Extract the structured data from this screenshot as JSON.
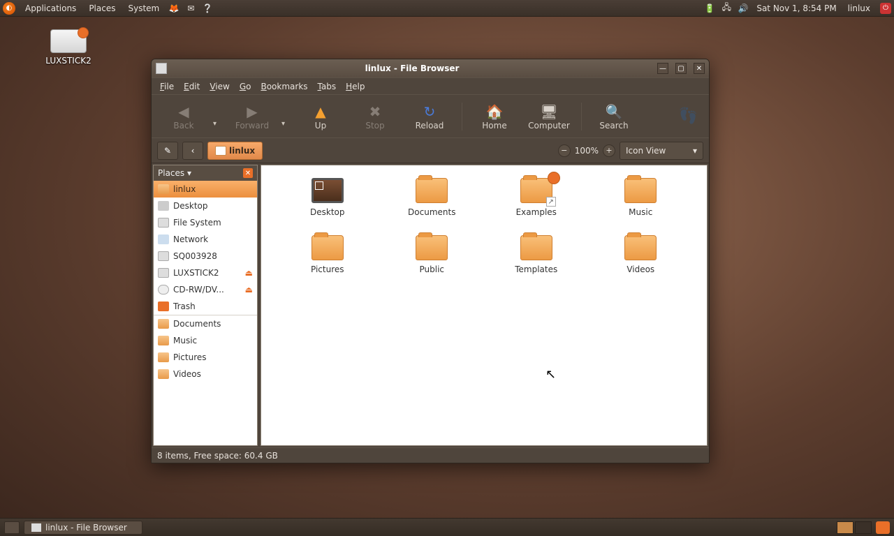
{
  "top_panel": {
    "menus": [
      "Applications",
      "Places",
      "System"
    ],
    "clock": "Sat Nov  1,  8:54 PM",
    "user": "linlux"
  },
  "desktop": {
    "drive_label": "LUXSTICK2"
  },
  "window": {
    "title": "linlux - File Browser",
    "menubar": {
      "file": "File",
      "edit": "Edit",
      "view": "View",
      "go": "Go",
      "bookmarks": "Bookmarks",
      "tabs": "Tabs",
      "help": "Help"
    },
    "toolbar": {
      "back": "Back",
      "forward": "Forward",
      "up": "Up",
      "stop": "Stop",
      "reload": "Reload",
      "home": "Home",
      "computer": "Computer",
      "search": "Search"
    },
    "location": {
      "current": "linlux",
      "zoom": "100%",
      "view_mode": "Icon View"
    },
    "sidebar": {
      "header": "Places",
      "places": [
        {
          "label": "linlux",
          "icon": "home",
          "selected": true
        },
        {
          "label": "Desktop",
          "icon": "desk"
        },
        {
          "label": "File System",
          "icon": "drive"
        },
        {
          "label": "Network",
          "icon": "net"
        },
        {
          "label": "SQ003928",
          "icon": "drive"
        },
        {
          "label": "LUXSTICK2",
          "icon": "drive",
          "eject": true
        },
        {
          "label": "CD-RW/DV...",
          "icon": "cd",
          "eject": true
        },
        {
          "label": "Trash",
          "icon": "trash"
        }
      ],
      "bookmarks": [
        {
          "label": "Documents"
        },
        {
          "label": "Music"
        },
        {
          "label": "Pictures"
        },
        {
          "label": "Videos"
        }
      ]
    },
    "contents": [
      {
        "label": "Desktop",
        "type": "desktop"
      },
      {
        "label": "Documents",
        "type": "folder"
      },
      {
        "label": "Examples",
        "type": "folder",
        "locked": true,
        "link": true
      },
      {
        "label": "Music",
        "type": "folder"
      },
      {
        "label": "Pictures",
        "type": "folder"
      },
      {
        "label": "Public",
        "type": "folder"
      },
      {
        "label": "Templates",
        "type": "folder"
      },
      {
        "label": "Videos",
        "type": "folder"
      }
    ],
    "status": "8 items, Free space: 60.4 GB"
  },
  "bottom_panel": {
    "task": "linlux - File Browser"
  }
}
